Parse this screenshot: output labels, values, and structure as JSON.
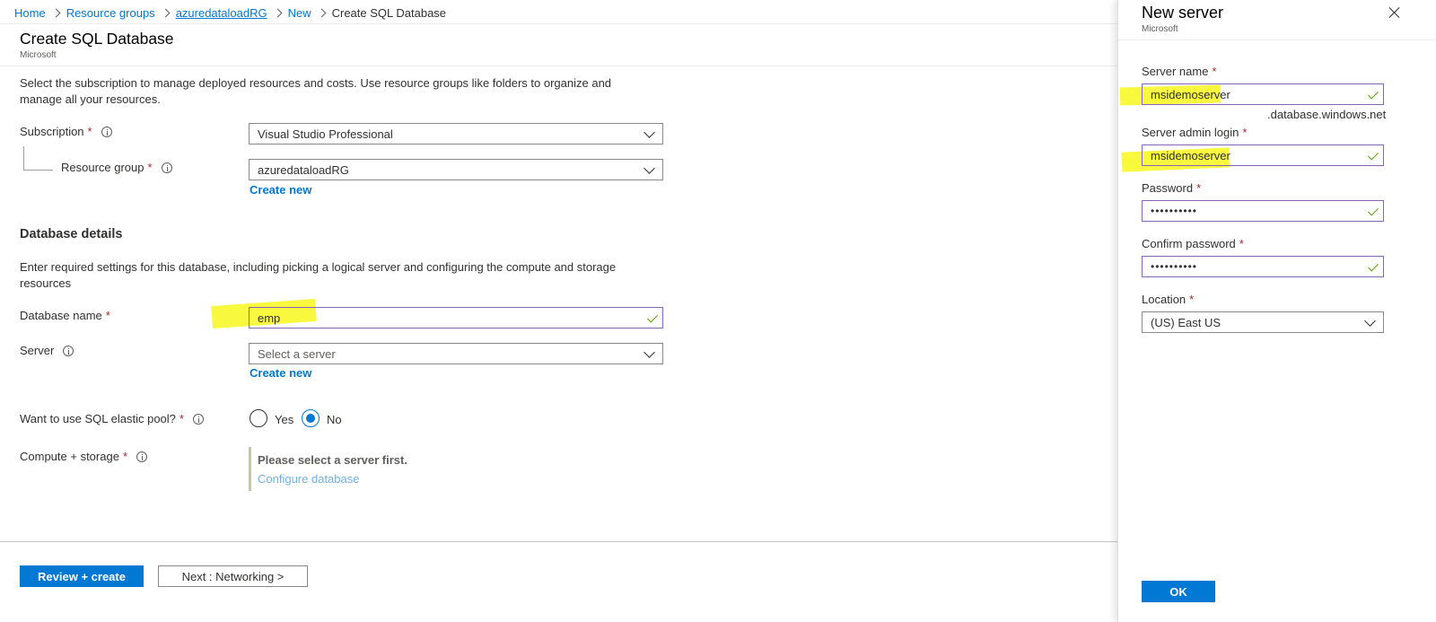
{
  "breadcrumb": {
    "items": [
      "Home",
      "Resource groups",
      "azuredataloadRG",
      "New",
      "Create SQL Database"
    ]
  },
  "page": {
    "title": "Create SQL Database",
    "subtitle": "Microsoft"
  },
  "project": {
    "description": "Select the subscription to manage deployed resources and costs. Use resource groups like folders to organize and manage all your resources.",
    "subscription_label": "Subscription",
    "subscription_value": "Visual Studio Professional",
    "resource_group_label": "Resource group",
    "resource_group_value": "azuredataloadRG",
    "create_new": "Create new"
  },
  "database_details": {
    "title": "Database details",
    "description": "Enter required settings for this database, including picking a logical server and configuring the compute and storage resources",
    "db_name_label": "Database name",
    "db_name_value": "emp",
    "server_label": "Server",
    "server_placeholder": "Select a server",
    "server_create_new": "Create new",
    "elastic_pool_label": "Want to use SQL elastic pool?",
    "elastic_yes": "Yes",
    "elastic_no": "No",
    "elastic_selected": "No",
    "compute_label": "Compute + storage",
    "compute_notice": "Please select a server first.",
    "compute_link": "Configure database"
  },
  "footer": {
    "review_create": "Review + create",
    "next": "Next : Networking >"
  },
  "blade": {
    "title": "New server",
    "subtitle": "Microsoft",
    "server_name_label": "Server name",
    "server_name_value": "msidemoserver",
    "domain_suffix": ".database.windows.net",
    "admin_login_label": "Server admin login",
    "admin_login_value": "msidemoserver",
    "password_label": "Password",
    "password_value": "••••••••••",
    "confirm_password_label": "Confirm password",
    "confirm_password_value": "••••••••••",
    "location_label": "Location",
    "location_value": "(US) East US",
    "ok": "OK"
  },
  "colors": {
    "accent": "#0078d4",
    "required": "#a4262c",
    "valid_check": "#57a300",
    "highlight": "#f7f71d"
  },
  "icons": [
    "chevron-right-icon",
    "info-icon",
    "chevron-down-icon",
    "checkmark-icon",
    "close-icon"
  ]
}
